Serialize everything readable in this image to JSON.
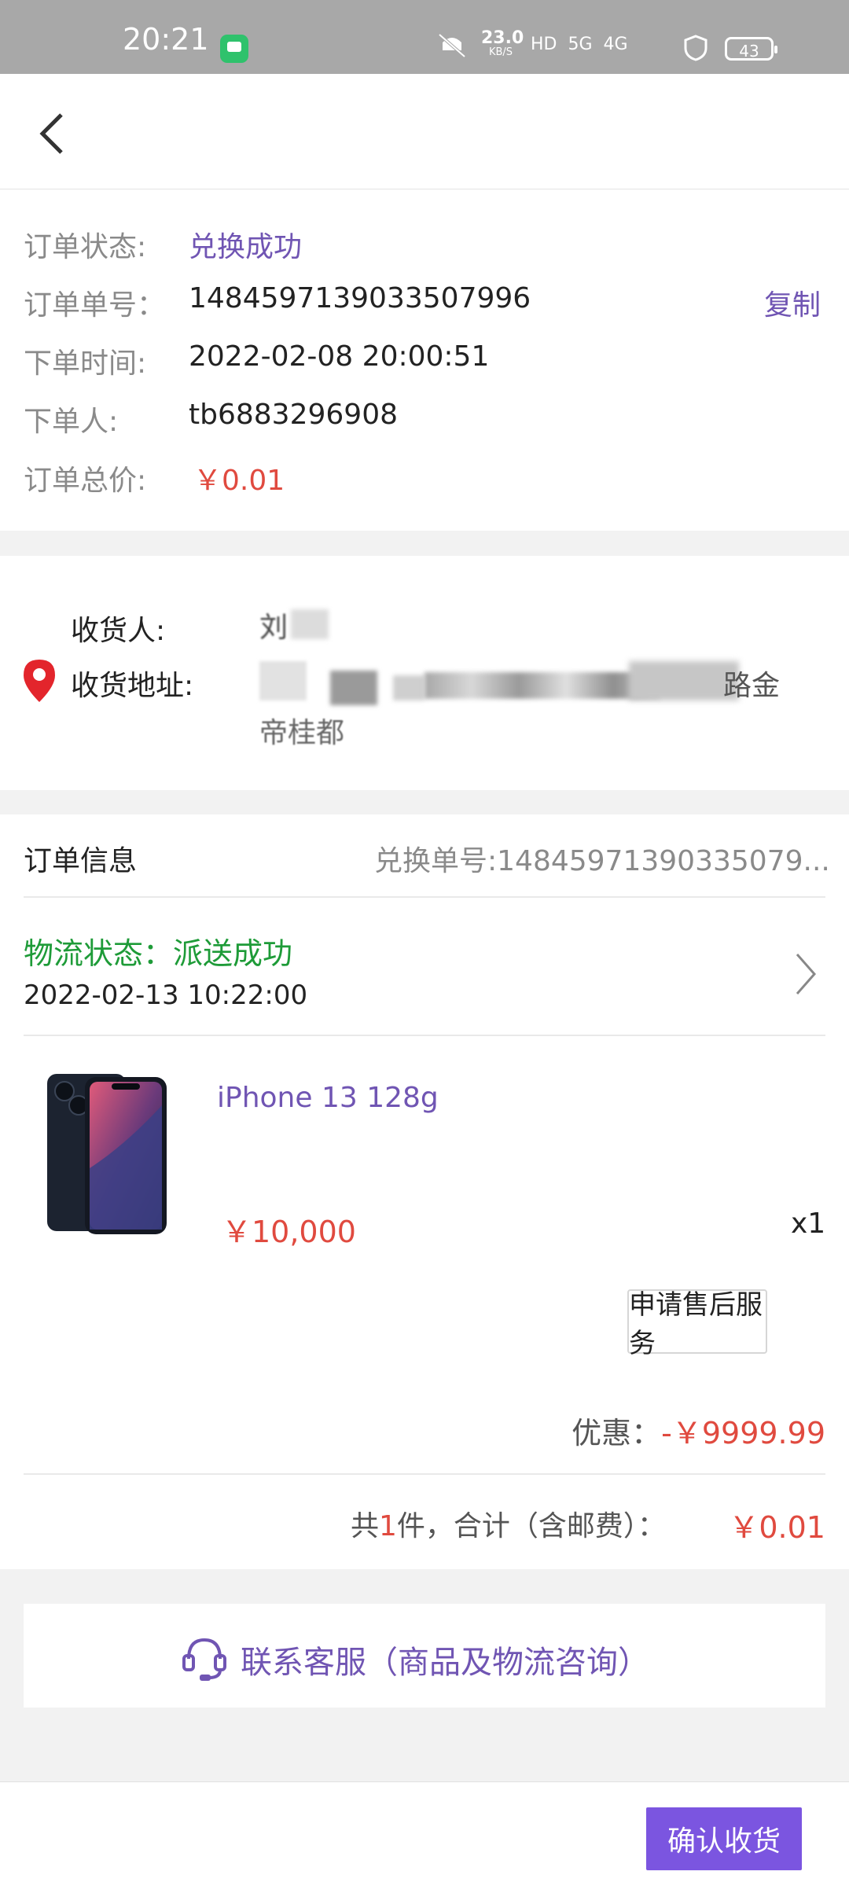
{
  "status_bar": {
    "time": "20:21",
    "net_speed": "23.0",
    "net_unit": "KB/S",
    "icons": "HD  5G  4G",
    "battery": "43"
  },
  "order": {
    "status_label": "订单状态:",
    "status_value": "兑换成功",
    "number_label": "订单单号：",
    "number_value": "1484597139033507996",
    "copy_label": "复制",
    "time_label": "下单时间:",
    "time_value": "2022-02-08 20:00:51",
    "buyer_label": "下单人:",
    "buyer_value": "tb6883296908",
    "total_label": "订单总价:",
    "total_value": "￥0.01"
  },
  "address": {
    "receiver_label": "收货人:",
    "receiver_value": "刘",
    "address_label": "收货地址:",
    "address_line1_tail": "路金",
    "address_line2": "帝桂都"
  },
  "order_info": {
    "title": "订单信息",
    "exchange_no": "兑换单号:14845971390335079...",
    "logistics_status": "物流状态：派送成功",
    "logistics_time": "2022-02-13 10:22:00"
  },
  "product": {
    "name": "iPhone 13 128g",
    "price": "￥10,000",
    "qty": "x1",
    "after_sales_button": "申请售后服务",
    "discount_label": "优惠：",
    "discount_value": "-￥9999.99",
    "summary_prefix": "共",
    "summary_count": "1",
    "summary_suffix": "件，合计（含邮费）：",
    "summary_total": "￥0.01"
  },
  "support": {
    "contact_label": "联系客服（商品及物流咨询）"
  },
  "footer": {
    "confirm_button": "确认收货"
  },
  "colors": {
    "accent": "#7055b3",
    "price_red": "#e04a3f",
    "status_green": "#1e9b38",
    "button_purple": "#7b55e0"
  }
}
